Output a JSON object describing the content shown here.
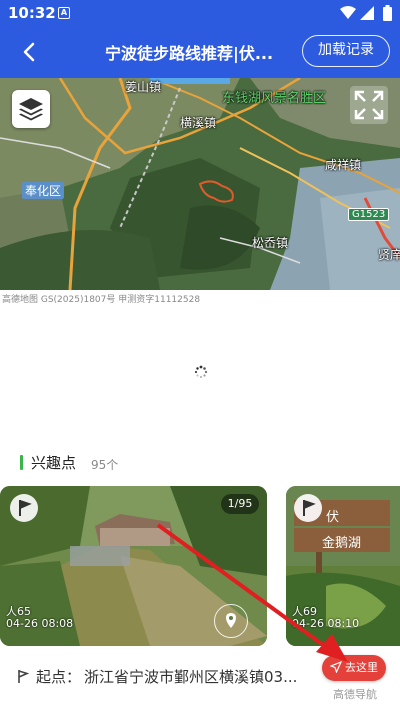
{
  "status_bar": {
    "time": "10:32",
    "notification_letter": "A"
  },
  "header": {
    "title": "宁波徒步路线推荐|伏...",
    "load_button": "加载记录"
  },
  "map": {
    "labels": {
      "jiangshan": "姜山镇",
      "hengxi": "横溪镇",
      "scenic": "东钱湖风景名胜区",
      "fenghua": "奉化区",
      "xianxiang": "咸祥镇",
      "road": "G1523",
      "songao": "松岙镇",
      "xianxiang2": "贤庠"
    },
    "attribution": "高德地图 GS(2025)1807号 甲测资字11112528"
  },
  "poi": {
    "title": "兴趣点",
    "count": "95个",
    "cards": [
      {
        "counter": "1/95",
        "likes": "人65",
        "date": "04-26 08:08"
      },
      {
        "likes": "人69",
        "date": "04-26 08:10",
        "sign_text_1": "伏",
        "sign_text_2": "金鹅湖"
      }
    ]
  },
  "start": {
    "label": "起点：",
    "address": "浙江省宁波市鄞州区横溪镇03...",
    "go_button": "去这里",
    "provider": "高德导航"
  },
  "colors": {
    "header": "#2d5be0",
    "accent_green": "#3bb54a",
    "go_red": "#e4413a"
  },
  "icons": [
    "back-arrow-icon",
    "layers-icon",
    "expand-icon",
    "flag-icon",
    "location-pin-icon",
    "navigate-icon",
    "loading-spinner-icon"
  ]
}
